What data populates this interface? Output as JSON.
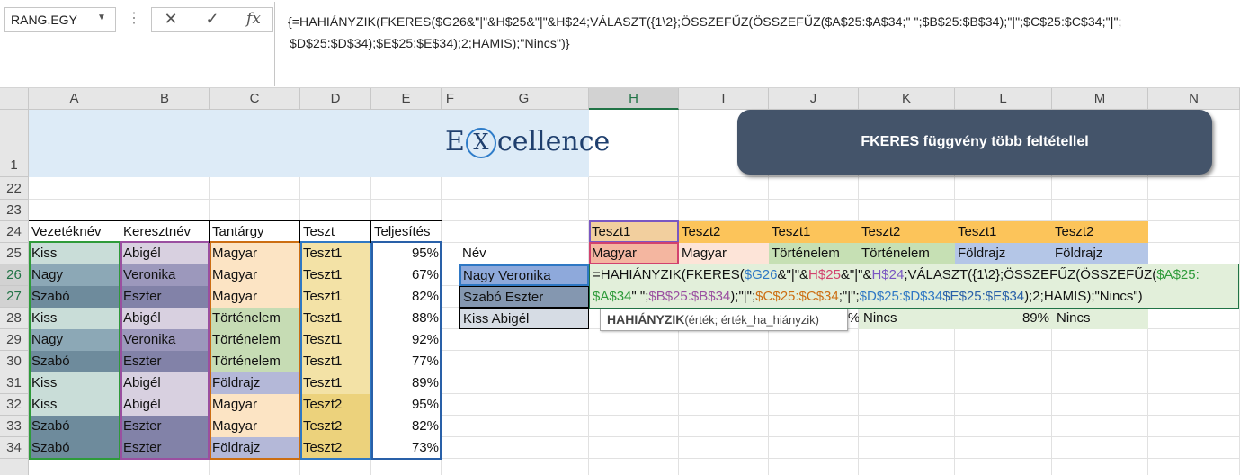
{
  "formula_bar": {
    "name_box": "RANG.EGY",
    "cancel_icon": "✕",
    "enter_icon": "✓",
    "fx_label": "fx",
    "formula_line1": "{=HAHIÁNYZIK(FKERES($G26&\"|\"&H$25&\"|\"&H$24;VÁLASZT({1\\2};ÖSSZEFŰZ(ÖSSZEFŰZ($A$25:$A$34;\" \";$B$25:$B$34);\"|\";$C$25:$C$34;\"|\";",
    "formula_line2": "$D$25:$D$34);$E$25:$E$34);2;HAMIS);\"Nincs\")}"
  },
  "columns": [
    "A",
    "B",
    "C",
    "D",
    "E",
    "F",
    "G",
    "H",
    "I",
    "J",
    "K",
    "L",
    "M",
    "N"
  ],
  "rows": [
    "1",
    "22",
    "23",
    "24",
    "25",
    "26",
    "27",
    "28",
    "29",
    "30",
    "31",
    "32",
    "33",
    "34"
  ],
  "banner": {
    "title": "FKERES függvény több feltétellel",
    "logo_e": "E",
    "logo_x": "X",
    "logo_rest": "cellence",
    "button_label": "FKERES függvény több feltétellel"
  },
  "table": {
    "headers": [
      "Vezetéknév",
      "Keresztnév",
      "Tantárgy",
      "Teszt",
      "Teljesítés"
    ],
    "rows": [
      [
        "Kiss",
        "Abigél",
        "Magyar",
        "Teszt1",
        "95%"
      ],
      [
        "Nagy",
        "Veronika",
        "Magyar",
        "Teszt1",
        "67%"
      ],
      [
        "Szabó",
        "Eszter",
        "Magyar",
        "Teszt1",
        "82%"
      ],
      [
        "Kiss",
        "Abigél",
        "Történelem",
        "Teszt1",
        "88%"
      ],
      [
        "Nagy",
        "Veronika",
        "Történelem",
        "Teszt1",
        "92%"
      ],
      [
        "Szabó",
        "Eszter",
        "Történelem",
        "Teszt1",
        "77%"
      ],
      [
        "Kiss",
        "Abigél",
        "Földrajz",
        "Teszt1",
        "89%"
      ],
      [
        "Kiss",
        "Abigél",
        "Magyar",
        "Teszt2",
        "95%"
      ],
      [
        "Szabó",
        "Eszter",
        "Magyar",
        "Teszt2",
        "82%"
      ],
      [
        "Szabó",
        "Eszter",
        "Földrajz",
        "Teszt2",
        "73%"
      ]
    ]
  },
  "lookup": {
    "test_row": [
      "Teszt1",
      "Teszt2",
      "Teszt1",
      "Teszt2",
      "Teszt1",
      "Teszt2"
    ],
    "subject_row": [
      "Magyar",
      "Magyar",
      "Történelem",
      "Történelem",
      "Földrajz",
      "Földrajz"
    ],
    "nev_label": "Név",
    "names": [
      "Nagy Veronika",
      "Szabó Eszter",
      "Kiss Abigél"
    ],
    "edit_line1_parts": [
      "=HAHIÁNYZIK(FKERES(",
      "$G26",
      "&\"|\"&",
      "H$25",
      "&\"|\"&",
      "H$24",
      "VÁLASZT({1\\2};ÖSSZEFŰZ(ÖSSZEFŰZ(",
      "$A$25:"
    ],
    "edit_line2_parts": [
      "$A$34",
      "\" \";",
      "$B$25:$B$34",
      ");\"|\";",
      "$C$25:$C$34",
      ";\"|\";",
      "$D$25:$D$34",
      "$E$25:$E$34",
      ");2;HAMIS);\"Nincs\")"
    ],
    "row28_values": [
      "%",
      "Nincs",
      "89%",
      "Nincs"
    ],
    "tooltip_bold": "HAHIÁNYZIK",
    "tooltip_rest": "(érték; érték_ha_hiányzik)"
  },
  "colors": {
    "banner_bg": "#ddebf7",
    "banner_text": "#44546a",
    "button_bg": "#44546a",
    "vezeteknev_colors": [
      "#c9ddd8",
      "#8ca8b6",
      "#6e8b9c"
    ],
    "keresztnev_colors": [
      "#d8d0e0",
      "#9c98bc",
      "#8282a8"
    ],
    "tantargy_colors": [
      "#fce4c4",
      "#c6dcb4",
      "#b4b8d8"
    ],
    "teszt_colors": [
      "#f3e2a6",
      "#ecd27c"
    ],
    "test_orange": "#fcc45a",
    "test_tan": "#f2cf9e",
    "subject_magyar": "#f8cbad",
    "subject_tortenelem": "#c6e0b4",
    "subject_foldrajz": "#b4c6e7",
    "green_band": "#e2efda"
  }
}
